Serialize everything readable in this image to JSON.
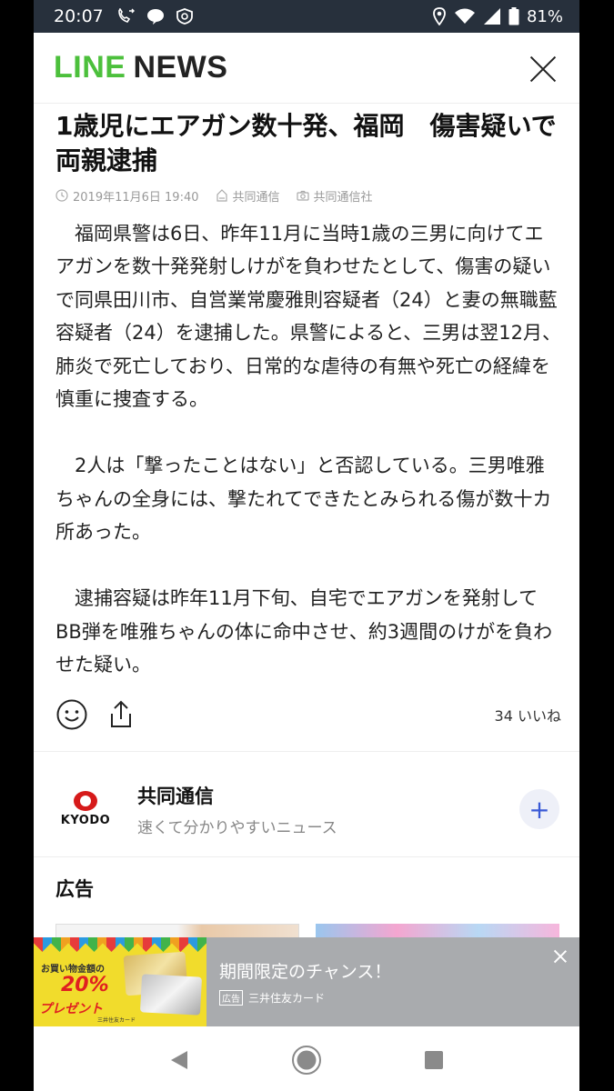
{
  "status_bar": {
    "time": "20:07",
    "battery": "81%"
  },
  "header": {
    "logo_line": "LINE",
    "logo_news": "NEWS"
  },
  "article": {
    "headline": "1歳児にエアガン数十発、福岡　傷害疑いで両親逮捕",
    "date": "2019年11月6日 19:40",
    "source": "共同通信",
    "photo_credit": "共同通信社",
    "paragraphs": [
      "福岡県警は6日、昨年11月に当時1歳の三男に向けてエアガンを数十発発射しけがを負わせたとして、傷害の疑いで同県田川市、自営業常慶雅則容疑者（24）と妻の無職藍容疑者（24）を逮捕した。県警によると、三男は翌12月、肺炎で死亡しており、日常的な虐待の有無や死亡の経緯を慎重に捜査する。",
      "2人は「撃ったことはない」と否認している。三男唯雅ちゃんの全身には、撃たれてできたとみられる傷が数十カ所あった。",
      "逮捕容疑は昨年11月下旬、自宅でエアガンを発射してBB弾を唯雅ちゃんの体に命中させ、約3週間のけがを負わせた疑い。"
    ],
    "likes": "34 いいね"
  },
  "publisher": {
    "logo_text": "KYODO",
    "name": "共同通信",
    "description": "速くて分かりやすいニュース",
    "follow_label": "+"
  },
  "ad": {
    "section_title": "広告",
    "banner": {
      "title": "期間限定のチャンス！",
      "badge": "広告",
      "sponsor": "三井住友カード",
      "img_promo": "お買い物金額の",
      "img_percent": "20%",
      "img_present": "プレゼント",
      "img_issuer": "三井住友カード"
    }
  },
  "colors": {
    "status_bar_bg": "#27303c",
    "line_green": "#4cc03c",
    "follow_blue": "#3a5ad6",
    "banner_bg": "#a9abae"
  }
}
